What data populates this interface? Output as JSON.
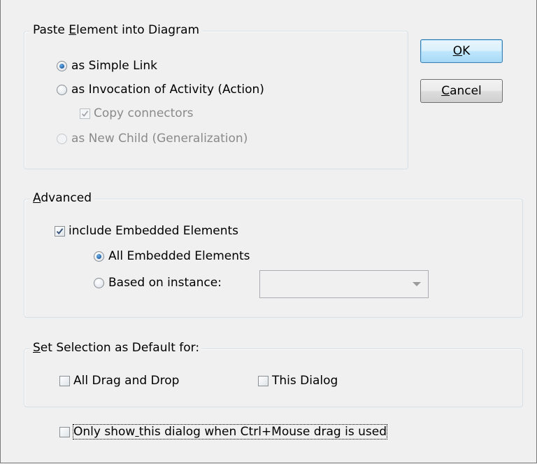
{
  "paste_group": {
    "title_pre": "Paste ",
    "title_accel": "E",
    "title_post": "lement into Diagram",
    "options": {
      "simple_link": "as Simple Link",
      "invocation": "as Invocation of Activity (Action)",
      "copy_connectors": "Copy connectors",
      "new_child": "as New Child (Generalization)"
    }
  },
  "advanced_group": {
    "title_accel": "A",
    "title_post": "dvanced",
    "include_embedded": "include Embedded Elements",
    "all_embedded": "All Embedded Elements",
    "based_on_instance": "Based on instance:",
    "instance_value": ""
  },
  "default_group": {
    "title_accel": "S",
    "title_post": "et Selection as Default for:",
    "all_drag_drop": "All Drag and Drop",
    "this_dialog": "This Dialog"
  },
  "ctrl_only": {
    "pre": "Only show",
    "accel": " ",
    "post": "this dialog when Ctrl+Mouse drag is used"
  },
  "buttons": {
    "ok_accel": "O",
    "ok_post": "K",
    "cancel_accel": "C",
    "cancel_post": "ancel"
  },
  "state": {
    "simple_link": true,
    "invocation": false,
    "copy_connectors": true,
    "new_child": false,
    "include_embedded": true,
    "all_embedded": true,
    "based_on_instance": false,
    "all_drag_drop": false,
    "this_dialog": false,
    "ctrl_only": false
  },
  "colors": {
    "accent": "#1f5fa6",
    "disabled_text": "#8a8a8a",
    "group_border": "#d5dfe5"
  }
}
